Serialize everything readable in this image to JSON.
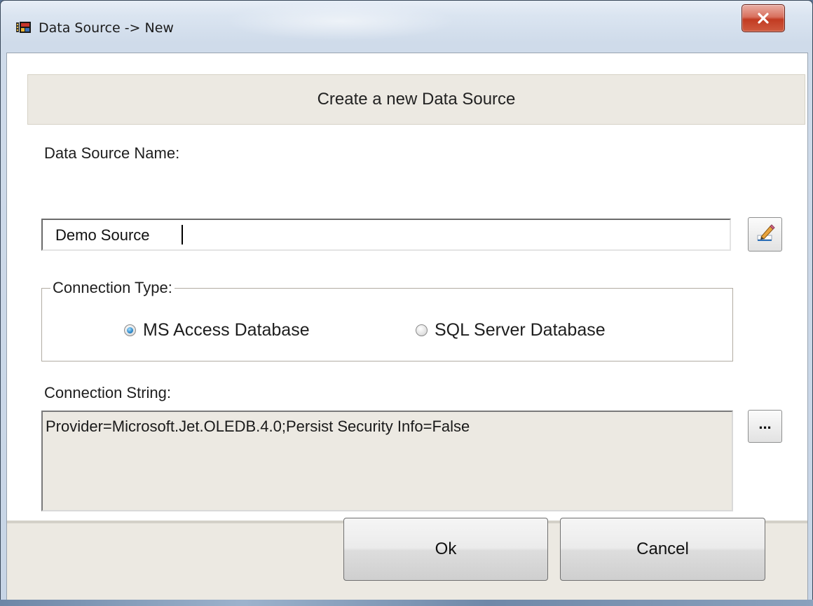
{
  "window": {
    "title": "Data Source -> New",
    "close_glyph": "X",
    "app_icon": "database-book-icon"
  },
  "header": {
    "text": "Create a new Data Source"
  },
  "name_field": {
    "label": "Data Source Name:",
    "value": "Demo Source",
    "edit_icon": "pencil-edit-icon"
  },
  "connection_type": {
    "legend": "Connection Type:",
    "options": [
      {
        "label": "MS Access Database",
        "selected": true
      },
      {
        "label": "SQL Server Database",
        "selected": false
      }
    ]
  },
  "connection_string": {
    "label": "Connection String:",
    "value": "Provider=Microsoft.Jet.OLEDB.4.0;Persist Security Info=False",
    "browse_label": "..."
  },
  "buttons": {
    "ok": "Ok",
    "cancel": "Cancel"
  },
  "colors": {
    "panel": "#ece9e2",
    "close_red": "#c23b22",
    "radio_blue": "#2c87c8"
  }
}
